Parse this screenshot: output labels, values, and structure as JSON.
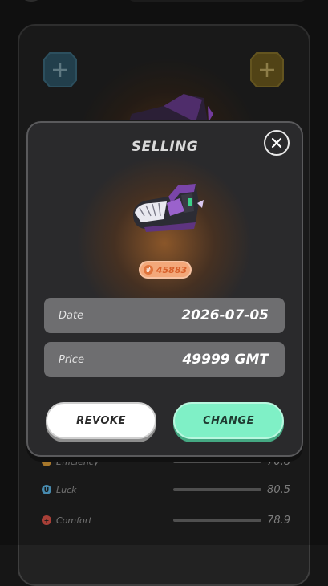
{
  "modal": {
    "title": "SELLING",
    "badge": {
      "hash": "#",
      "number": "45883"
    },
    "date": {
      "label": "Date",
      "value": "2026-07-05"
    },
    "price": {
      "label": "Price",
      "value": "49999 GMT"
    },
    "buttons": {
      "revoke": "REVOKE",
      "change": "CHANGE"
    }
  },
  "stats": [
    {
      "label": "Efficiency",
      "value": "70.8",
      "icon_letter": "",
      "color": "#e0a13a",
      "level": 0.708
    },
    {
      "label": "Luck",
      "value": "80.5",
      "icon_letter": "U",
      "color": "#5fb8e8",
      "level": 0.805
    },
    {
      "label": "Comfort",
      "value": "78.9",
      "icon_letter": "+",
      "color": "#e0554a",
      "level": 0.789
    }
  ],
  "colors": {
    "accent_green": "#7ff0c6",
    "badge_orange": "#f3a87a",
    "slot_blue": "#2e5566",
    "slot_gold": "#6d5a1e"
  }
}
